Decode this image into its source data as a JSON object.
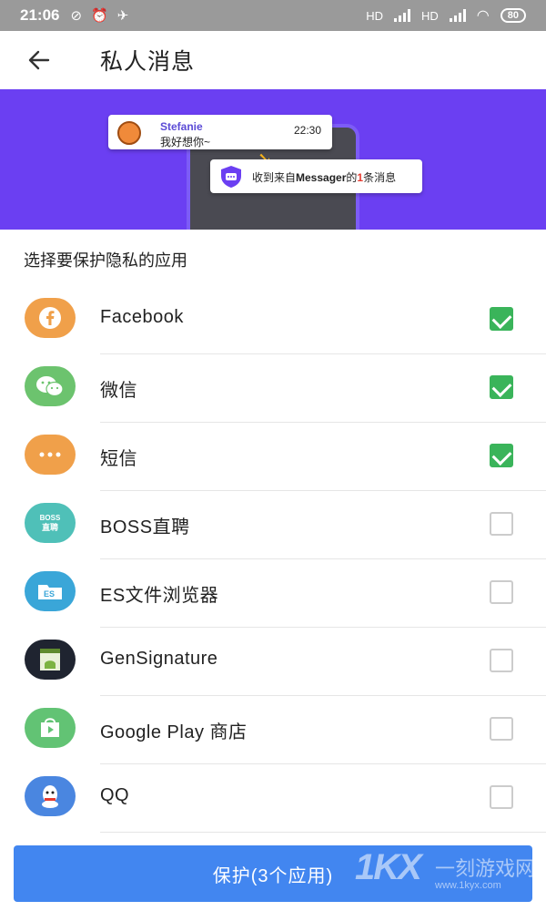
{
  "status_bar": {
    "time": "21:06",
    "network_labels": [
      "HD",
      "HD"
    ],
    "battery": "80"
  },
  "header": {
    "title": "私人消息",
    "back_icon": "arrow-left-icon"
  },
  "banner": {
    "notification": {
      "sender": "Stefanie",
      "message": "我好想你~",
      "time": "22:30"
    },
    "summary": {
      "prefix": "收到来自",
      "app": "Messager",
      "mid": "的",
      "count": "1",
      "suffix": "条消息"
    }
  },
  "section_title": "选择要保护隐私的应用",
  "apps": [
    {
      "name": "Facebook",
      "checked": true,
      "icon": "facebook-icon",
      "color": "#f0a04a"
    },
    {
      "name": "微信",
      "checked": true,
      "icon": "wechat-icon",
      "color": "#6cc36e"
    },
    {
      "name": "短信",
      "checked": true,
      "icon": "sms-icon",
      "color": "#f0a04a"
    },
    {
      "name": "BOSS直聘",
      "checked": false,
      "icon": "boss-icon",
      "color": "#4fc0b8"
    },
    {
      "name": "ES文件浏览器",
      "checked": false,
      "icon": "es-file-icon",
      "color": "#3aa6d8"
    },
    {
      "name": "GenSignature",
      "checked": false,
      "icon": "android-icon",
      "color": "#1f2430"
    },
    {
      "name": "Google Play 商店",
      "checked": false,
      "icon": "google-play-icon",
      "color": "#62c374"
    },
    {
      "name": "QQ",
      "checked": false,
      "icon": "qq-icon",
      "color": "#4a86e0"
    }
  ],
  "protect_button": "保护(3个应用)",
  "watermark": {
    "logo": "1KX",
    "text": "一刻游戏网",
    "url": "www.1kyx.com"
  },
  "colors": {
    "banner": "#6b3ff2",
    "checkbox_on": "#3ab45a",
    "button": "#4286f0"
  }
}
